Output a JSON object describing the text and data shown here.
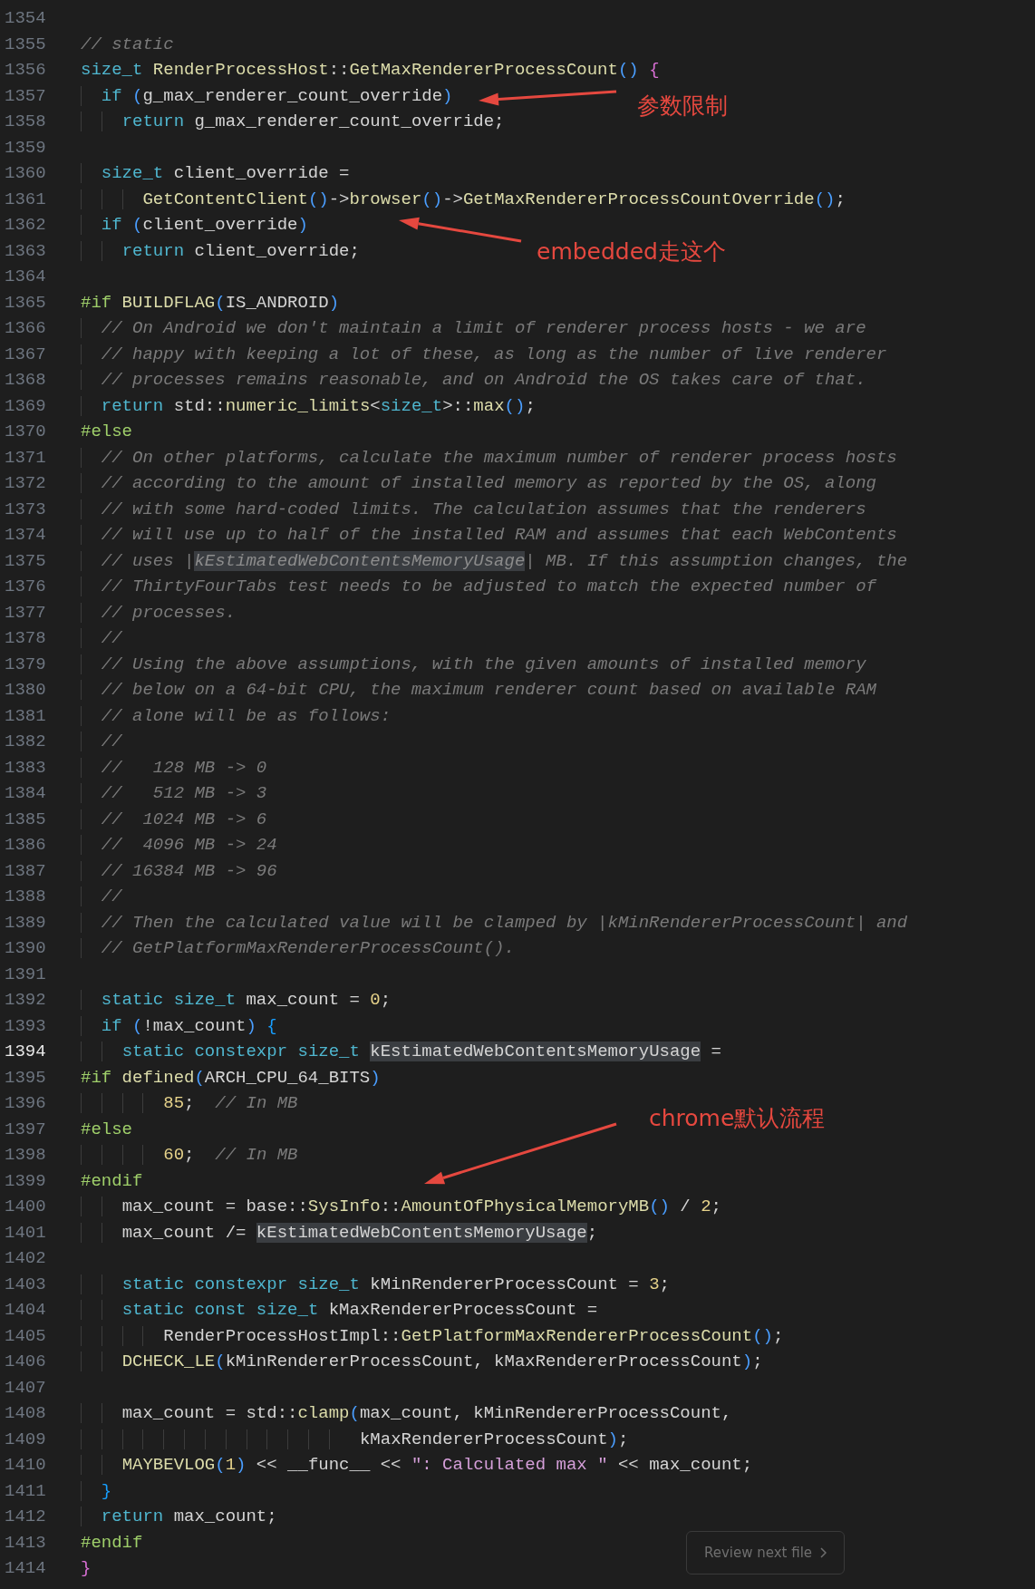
{
  "editor": {
    "lines": [
      {
        "number": "1354",
        "current": false
      },
      {
        "number": "1355",
        "current": false,
        "tokens": [
          {
            "kind": "comment",
            "text": "// static"
          }
        ]
      },
      {
        "number": "1356",
        "current": false,
        "tokens": [
          {
            "kind": "type",
            "text": "size_t"
          },
          {
            "kind": "function",
            "text": " RenderProcessHost"
          },
          {
            "kind": "plain",
            "text": "::"
          },
          {
            "kind": "function",
            "text": "GetMaxRendererProcessCount"
          },
          {
            "kind": "paren",
            "text": "()"
          },
          {
            "kind": "brace",
            "text": " {"
          }
        ]
      },
      {
        "number": "1357",
        "current": false,
        "tokens": [
          {
            "kind": "keyword",
            "text": "  if"
          },
          {
            "kind": "paren",
            "text": " ("
          },
          {
            "kind": "plain",
            "text": "g_max_renderer_count_override"
          },
          {
            "kind": "paren",
            "text": ")"
          }
        ]
      },
      {
        "number": "1358",
        "current": false,
        "tokens": [
          {
            "kind": "keyword",
            "text": "    return"
          },
          {
            "kind": "plain",
            "text": " g_max_renderer_count_override;"
          }
        ]
      },
      {
        "number": "1359",
        "current": false
      },
      {
        "number": "1360",
        "current": false,
        "tokens": [
          {
            "kind": "type",
            "text": "  size_t"
          },
          {
            "kind": "plain",
            "text": " client_override ="
          }
        ]
      },
      {
        "number": "1361",
        "current": false,
        "tokens": [
          {
            "kind": "function",
            "text": "      GetContentClient"
          },
          {
            "kind": "paren",
            "text": "()"
          },
          {
            "kind": "plain",
            "text": "->"
          },
          {
            "kind": "function",
            "text": "browser"
          },
          {
            "kind": "paren",
            "text": "()"
          },
          {
            "kind": "plain",
            "text": "->"
          },
          {
            "kind": "function",
            "text": "GetMaxRendererProcessCountOverride"
          },
          {
            "kind": "paren",
            "text": "()"
          },
          {
            "kind": "plain",
            "text": ";"
          }
        ]
      },
      {
        "number": "1362",
        "current": false,
        "tokens": [
          {
            "kind": "keyword",
            "text": "  if"
          },
          {
            "kind": "paren",
            "text": " ("
          },
          {
            "kind": "plain",
            "text": "client_override"
          },
          {
            "kind": "paren",
            "text": ")"
          }
        ]
      },
      {
        "number": "1363",
        "current": false,
        "tokens": [
          {
            "kind": "keyword",
            "text": "    return"
          },
          {
            "kind": "plain",
            "text": " client_override;"
          }
        ]
      },
      {
        "number": "1364",
        "current": false
      },
      {
        "number": "1365",
        "current": false,
        "tokens": [
          {
            "kind": "preprocessor",
            "text": "#if"
          },
          {
            "kind": "function",
            "text": " BUILDFLAG"
          },
          {
            "kind": "paren",
            "text": "("
          },
          {
            "kind": "plain",
            "text": "IS_ANDROID"
          },
          {
            "kind": "paren",
            "text": ")"
          }
        ]
      },
      {
        "number": "1366",
        "current": false,
        "tokens": [
          {
            "kind": "comment",
            "text": "  // On Android we don't maintain a limit of renderer process hosts - we are"
          }
        ]
      },
      {
        "number": "1367",
        "current": false,
        "tokens": [
          {
            "kind": "comment",
            "text": "  // happy with keeping a lot of these, as long as the number of live renderer"
          }
        ]
      },
      {
        "number": "1368",
        "current": false,
        "tokens": [
          {
            "kind": "comment",
            "text": "  // processes remains reasonable, and on Android the OS takes care of that."
          }
        ]
      },
      {
        "number": "1369",
        "current": false,
        "tokens": [
          {
            "kind": "keyword",
            "text": "  return"
          },
          {
            "kind": "plain",
            "text": " std::"
          },
          {
            "kind": "function",
            "text": "numeric_limits"
          },
          {
            "kind": "plain",
            "text": "<"
          },
          {
            "kind": "type",
            "text": "size_t"
          },
          {
            "kind": "plain",
            "text": ">::"
          },
          {
            "kind": "function",
            "text": "max"
          },
          {
            "kind": "paren",
            "text": "()"
          },
          {
            "kind": "plain",
            "text": ";"
          }
        ]
      },
      {
        "number": "1370",
        "current": false,
        "tokens": [
          {
            "kind": "preprocessor",
            "text": "#else"
          }
        ]
      },
      {
        "number": "1371",
        "current": false,
        "tokens": [
          {
            "kind": "comment",
            "text": "  // On other platforms, calculate the maximum number of renderer process hosts"
          }
        ]
      },
      {
        "number": "1372",
        "current": false,
        "tokens": [
          {
            "kind": "comment",
            "text": "  // according to the amount of installed memory as reported by the OS, along"
          }
        ]
      },
      {
        "number": "1373",
        "current": false,
        "tokens": [
          {
            "kind": "comment",
            "text": "  // with some hard-coded limits. The calculation assumes that the renderers"
          }
        ]
      },
      {
        "number": "1374",
        "current": false,
        "tokens": [
          {
            "kind": "comment",
            "text": "  // will use up to half of the installed RAM and assumes that each WebContents"
          }
        ]
      },
      {
        "number": "1375",
        "current": false,
        "tokens": [
          {
            "kind": "comment",
            "text": "  // uses |"
          },
          {
            "kind": "comment-match",
            "text": "kEstimatedWebContentsMemoryUsage"
          },
          {
            "kind": "comment",
            "text": "| MB. If this assumption changes, the"
          }
        ]
      },
      {
        "number": "1376",
        "current": false,
        "tokens": [
          {
            "kind": "comment",
            "text": "  // ThirtyFourTabs test needs to be adjusted to match the expected number of"
          }
        ]
      },
      {
        "number": "1377",
        "current": false,
        "tokens": [
          {
            "kind": "comment",
            "text": "  // processes."
          }
        ]
      },
      {
        "number": "1378",
        "current": false,
        "tokens": [
          {
            "kind": "comment",
            "text": "  //"
          }
        ]
      },
      {
        "number": "1379",
        "current": false,
        "tokens": [
          {
            "kind": "comment",
            "text": "  // Using the above assumptions, with the given amounts of installed memory"
          }
        ]
      },
      {
        "number": "1380",
        "current": false,
        "tokens": [
          {
            "kind": "comment",
            "text": "  // below on a 64-bit CPU, the maximum renderer count based on available RAM"
          }
        ]
      },
      {
        "number": "1381",
        "current": false,
        "tokens": [
          {
            "kind": "comment",
            "text": "  // alone will be as follows:"
          }
        ]
      },
      {
        "number": "1382",
        "current": false,
        "tokens": [
          {
            "kind": "comment",
            "text": "  //"
          }
        ]
      },
      {
        "number": "1383",
        "current": false,
        "tokens": [
          {
            "kind": "comment",
            "text": "  //   128 MB -> 0"
          }
        ]
      },
      {
        "number": "1384",
        "current": false,
        "tokens": [
          {
            "kind": "comment",
            "text": "  //   512 MB -> 3"
          }
        ]
      },
      {
        "number": "1385",
        "current": false,
        "tokens": [
          {
            "kind": "comment",
            "text": "  //  1024 MB -> 6"
          }
        ]
      },
      {
        "number": "1386",
        "current": false,
        "tokens": [
          {
            "kind": "comment",
            "text": "  //  4096 MB -> 24"
          }
        ]
      },
      {
        "number": "1387",
        "current": false,
        "tokens": [
          {
            "kind": "comment",
            "text": "  // 16384 MB -> 96"
          }
        ]
      },
      {
        "number": "1388",
        "current": false,
        "tokens": [
          {
            "kind": "comment",
            "text": "  //"
          }
        ]
      },
      {
        "number": "1389",
        "current": false,
        "tokens": [
          {
            "kind": "comment",
            "text": "  // Then the calculated value will be clamped by |kMinRendererProcessCount| and"
          }
        ]
      },
      {
        "number": "1390",
        "current": false,
        "tokens": [
          {
            "kind": "comment",
            "text": "  // GetPlatformMaxRendererProcessCount()."
          }
        ]
      },
      {
        "number": "1391",
        "current": false
      },
      {
        "number": "1392",
        "current": false,
        "tokens": [
          {
            "kind": "keyword",
            "text": "  static"
          },
          {
            "kind": "type",
            "text": " size_t"
          },
          {
            "kind": "plain",
            "text": " max_count = "
          },
          {
            "kind": "number",
            "text": "0"
          },
          {
            "kind": "plain",
            "text": ";"
          }
        ]
      },
      {
        "number": "1393",
        "current": false,
        "tokens": [
          {
            "kind": "keyword",
            "text": "  if"
          },
          {
            "kind": "paren",
            "text": " ("
          },
          {
            "kind": "plain",
            "text": "!max_count"
          },
          {
            "kind": "paren",
            "text": ")"
          },
          {
            "kind": "bracket",
            "text": " {"
          }
        ]
      },
      {
        "number": "1394",
        "current": true,
        "tokens": [
          {
            "kind": "keyword",
            "text": "    static"
          },
          {
            "kind": "keyword",
            "text": " constexpr"
          },
          {
            "kind": "type",
            "text": " size_t "
          },
          {
            "kind": "match",
            "text": "kEstimatedWebContentsMemoryUsage"
          },
          {
            "kind": "plain",
            "text": " ="
          }
        ]
      },
      {
        "number": "1395",
        "current": false,
        "tokens": [
          {
            "kind": "preprocessor",
            "text": "#if"
          },
          {
            "kind": "function",
            "text": " defined"
          },
          {
            "kind": "paren",
            "text": "("
          },
          {
            "kind": "plain",
            "text": "ARCH_CPU_64_BITS"
          },
          {
            "kind": "paren",
            "text": ")"
          }
        ]
      },
      {
        "number": "1396",
        "current": false,
        "tokens": [
          {
            "kind": "number",
            "text": "        85"
          },
          {
            "kind": "plain",
            "text": ";"
          },
          {
            "kind": "comment",
            "text": "  // In MB"
          }
        ]
      },
      {
        "number": "1397",
        "current": false,
        "tokens": [
          {
            "kind": "preprocessor",
            "text": "#else"
          }
        ]
      },
      {
        "number": "1398",
        "current": false,
        "tokens": [
          {
            "kind": "number",
            "text": "        60"
          },
          {
            "kind": "plain",
            "text": ";"
          },
          {
            "kind": "comment",
            "text": "  // In MB"
          }
        ]
      },
      {
        "number": "1399",
        "current": false,
        "tokens": [
          {
            "kind": "preprocessor",
            "text": "#endif"
          }
        ]
      },
      {
        "number": "1400",
        "current": false,
        "tokens": [
          {
            "kind": "plain",
            "text": "    max_count = base::"
          },
          {
            "kind": "function",
            "text": "SysInfo"
          },
          {
            "kind": "plain",
            "text": "::"
          },
          {
            "kind": "function",
            "text": "AmountOfPhysicalMemoryMB"
          },
          {
            "kind": "paren",
            "text": "()"
          },
          {
            "kind": "plain",
            "text": " / "
          },
          {
            "kind": "number",
            "text": "2"
          },
          {
            "kind": "plain",
            "text": ";"
          }
        ]
      },
      {
        "number": "1401",
        "current": false,
        "tokens": [
          {
            "kind": "plain",
            "text": "    max_count /= "
          },
          {
            "kind": "match",
            "text": "kEstimatedWebContentsMemoryUsage"
          },
          {
            "kind": "plain",
            "text": ";"
          }
        ]
      },
      {
        "number": "1402",
        "current": false
      },
      {
        "number": "1403",
        "current": false,
        "tokens": [
          {
            "kind": "keyword",
            "text": "    static"
          },
          {
            "kind": "keyword",
            "text": " constexpr"
          },
          {
            "kind": "type",
            "text": " size_t"
          },
          {
            "kind": "plain",
            "text": " kMinRendererProcessCount = "
          },
          {
            "kind": "number",
            "text": "3"
          },
          {
            "kind": "plain",
            "text": ";"
          }
        ]
      },
      {
        "number": "1404",
        "current": false,
        "tokens": [
          {
            "kind": "keyword",
            "text": "    static"
          },
          {
            "kind": "keyword",
            "text": " const"
          },
          {
            "kind": "type",
            "text": " size_t"
          },
          {
            "kind": "plain",
            "text": " kMaxRendererProcessCount ="
          }
        ]
      },
      {
        "number": "1405",
        "current": false,
        "tokens": [
          {
            "kind": "plain",
            "text": "        RenderProcessHostImpl::"
          },
          {
            "kind": "function",
            "text": "GetPlatformMaxRendererProcessCount"
          },
          {
            "kind": "paren",
            "text": "()"
          },
          {
            "kind": "plain",
            "text": ";"
          }
        ]
      },
      {
        "number": "1406",
        "current": false,
        "tokens": [
          {
            "kind": "function",
            "text": "    DCHECK_LE"
          },
          {
            "kind": "paren",
            "text": "("
          },
          {
            "kind": "plain",
            "text": "kMinRendererProcessCount, kMaxRendererProcessCount"
          },
          {
            "kind": "paren",
            "text": ")"
          },
          {
            "kind": "plain",
            "text": ";"
          }
        ]
      },
      {
        "number": "1407",
        "current": false
      },
      {
        "number": "1408",
        "current": false,
        "tokens": [
          {
            "kind": "plain",
            "text": "    max_count = std::"
          },
          {
            "kind": "function",
            "text": "clamp"
          },
          {
            "kind": "paren",
            "text": "("
          },
          {
            "kind": "plain",
            "text": "max_count, kMinRendererProcessCount,"
          }
        ]
      },
      {
        "number": "1409",
        "current": false,
        "tokens": [
          {
            "kind": "plain",
            "text": "                           kMaxRendererProcessCount"
          },
          {
            "kind": "paren",
            "text": ")"
          },
          {
            "kind": "plain",
            "text": ";"
          }
        ]
      },
      {
        "number": "1410",
        "current": false,
        "tokens": [
          {
            "kind": "function",
            "text": "    MAYBEVLOG"
          },
          {
            "kind": "paren",
            "text": "("
          },
          {
            "kind": "number",
            "text": "1"
          },
          {
            "kind": "paren",
            "text": ")"
          },
          {
            "kind": "plain",
            "text": " << __func__ << "
          },
          {
            "kind": "string",
            "text": "\": Calculated max \""
          },
          {
            "kind": "plain",
            "text": " << max_count;"
          }
        ]
      },
      {
        "number": "1411",
        "current": false,
        "tokens": [
          {
            "kind": "bracket",
            "text": "  }"
          }
        ]
      },
      {
        "number": "1412",
        "current": false,
        "tokens": [
          {
            "kind": "keyword",
            "text": "  return"
          },
          {
            "kind": "plain",
            "text": " max_count;"
          }
        ]
      },
      {
        "number": "1413",
        "current": false,
        "tokens": [
          {
            "kind": "preprocessor",
            "text": "#endif"
          }
        ]
      },
      {
        "number": "1414",
        "current": false,
        "tokens": [
          {
            "kind": "brace",
            "text": "}"
          }
        ]
      }
    ]
  },
  "annotations": [
    {
      "text": "参数限制"
    },
    {
      "text": "embedded走这个"
    },
    {
      "text": "chrome默认流程"
    }
  ],
  "review_button": {
    "label": "Review next file"
  }
}
